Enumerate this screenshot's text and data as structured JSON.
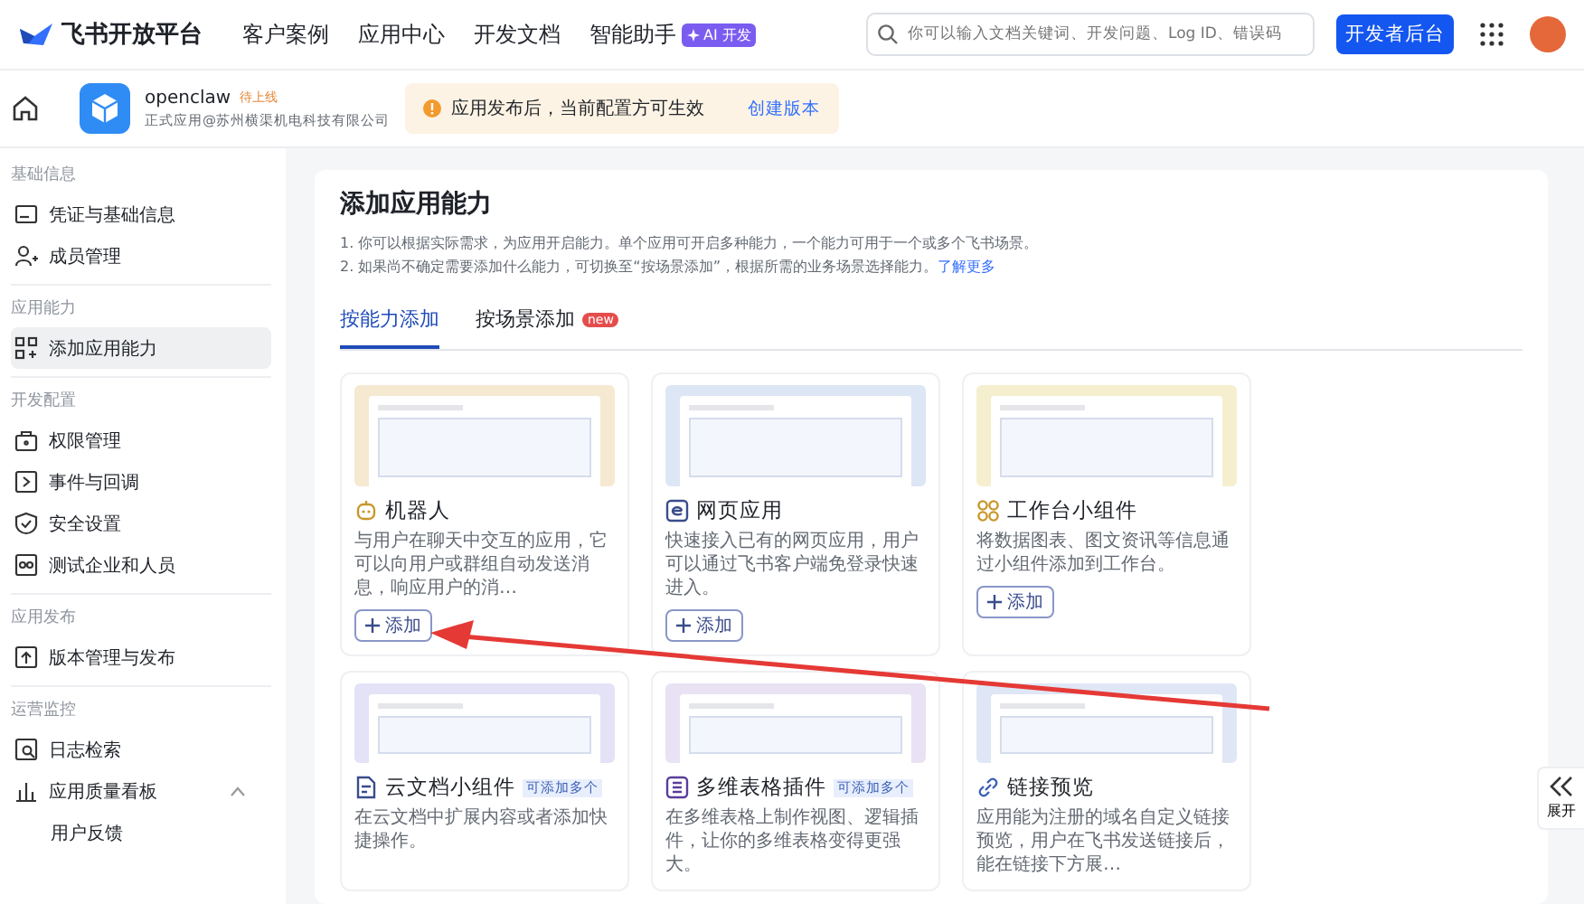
{
  "topnav": {
    "brand": "飞书开放平台",
    "links": [
      {
        "label": "客户案例"
      },
      {
        "label": "应用中心"
      },
      {
        "label": "开发文档"
      },
      {
        "label": "智能助手",
        "badge": "AI 开发"
      }
    ],
    "search": {
      "placeholder": "你可以输入文档关键词、开发问题、Log ID、错误码"
    },
    "console_button": "开发者后台"
  },
  "app_header": {
    "name": "openclaw",
    "status": "待上线",
    "owner": "正式应用@苏州横渠机电科技有限公司",
    "notice": "应用发布后，当前配置方可生效",
    "notice_action": "创建版本"
  },
  "sidebar": {
    "groups": [
      {
        "title": "基础信息",
        "items": [
          {
            "label": "凭证与基础信息",
            "kind": "card",
            "selected": false
          },
          {
            "label": "成员管理",
            "kind": "person",
            "selected": false
          }
        ]
      },
      {
        "title": "应用能力",
        "items": [
          {
            "label": "添加应用能力",
            "kind": "grid",
            "selected": true
          }
        ]
      },
      {
        "title": "开发配置",
        "items": [
          {
            "label": "权限管理",
            "kind": "lock",
            "selected": false
          },
          {
            "label": "事件与回调",
            "kind": "event",
            "selected": false
          },
          {
            "label": "安全设置",
            "kind": "shield",
            "selected": false
          },
          {
            "label": "测试企业和人员",
            "kind": "test",
            "selected": false
          }
        ]
      },
      {
        "title": "应用发布",
        "items": [
          {
            "label": "版本管理与发布",
            "kind": "upload",
            "selected": false
          }
        ]
      },
      {
        "title": "运营监控",
        "items": [
          {
            "label": "日志检索",
            "kind": "log",
            "selected": false
          },
          {
            "label": "应用质量看板",
            "kind": "chart",
            "selected": false,
            "expanded": true,
            "children": [
              {
                "label": "用户反馈",
                "selected": false
              }
            ]
          }
        ]
      }
    ]
  },
  "panel": {
    "title": "添加应用能力",
    "notes": [
      "1. 你可以根据实际需求，为应用开启能力。单个应用可开启多种能力，一个能力可用于一个或多个飞书场景。",
      "2. 如果尚不确定需要添加什么能力，可切换至“按场景添加”，根据所需的业务场景选择能力。"
    ],
    "learn_more": "了解更多",
    "tabs": [
      {
        "label": "按能力添加",
        "selected": true
      },
      {
        "label": "按场景添加",
        "selected": false,
        "badge": "new"
      }
    ],
    "cards": [
      {
        "title": "机器人",
        "kind": "robot",
        "color": "#f6e9d2",
        "desc": "与用户在聊天中交互的应用，它可以向用户或群组自动发送消息，响应用户的消…",
        "button": "添加"
      },
      {
        "title": "网页应用",
        "kind": "web",
        "color": "#dde6f5",
        "desc": "快速接入已有的网页应用，用户可以通过飞书客户端免登录快速进入。",
        "button": "添加"
      },
      {
        "title": "工作台小组件",
        "kind": "widget",
        "color": "#f5efcf",
        "desc": "将数据图表、图文资讯等信息通过小组件添加到工作台。",
        "button": "添加"
      },
      {
        "title": "云文档小组件",
        "kind": "doc",
        "color": "#e3e2f6",
        "tag": "可添加多个",
        "desc": "在云文档中扩展内容或者添加快捷操作。"
      },
      {
        "title": "多维表格插件",
        "kind": "table",
        "color": "#e8e2f4",
        "tag": "可添加多个",
        "desc": "在多维表格上制作视图、逻辑插件，让你的多维表格变得更强大。"
      },
      {
        "title": "链接预览",
        "kind": "link",
        "color": "#dfe6f6",
        "desc": "应用能为注册的域名自定义链接预览，用户在飞书发送链接后，能在链接下方展…"
      }
    ]
  },
  "expand_button": "展开"
}
